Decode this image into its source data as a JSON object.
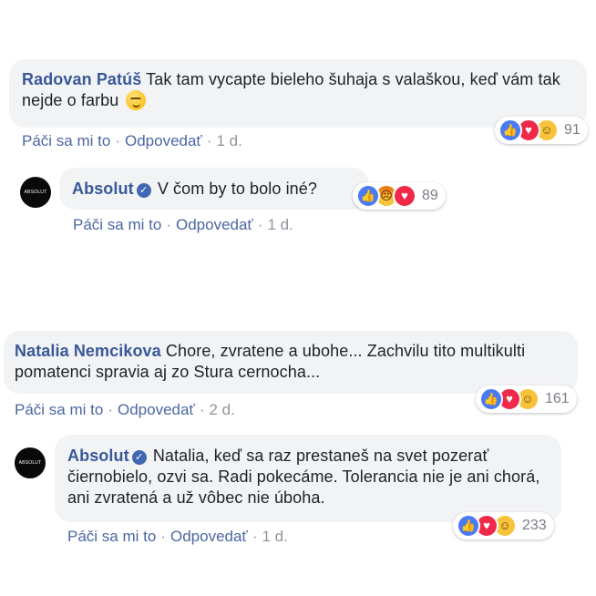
{
  "comments": [
    {
      "author": "Radovan Patúš",
      "text": "Tak tam vycapte bieleho šuhaja s valaškou, keď vám tak nejde o farbu",
      "actions": {
        "like": "Páči sa mi to",
        "reply": "Odpovedať",
        "time": "1 d."
      },
      "reactions": {
        "types": [
          "like",
          "love",
          "haha"
        ],
        "count": "91"
      }
    },
    {
      "author": "Absolut",
      "avatar_text": "ABSOLUT",
      "verified": true,
      "text": "V čom by to bolo iné?",
      "actions": {
        "like": "Páči sa mi to",
        "reply": "Odpovedať",
        "time": "1 d."
      },
      "reactions": {
        "types": [
          "like",
          "angry",
          "love"
        ],
        "count": "89"
      }
    },
    {
      "author": "Natalia Nemcikova",
      "text": "Chore, zvratene a ubohe... Zachvilu tito multikulti pomatenci spravia aj zo Stura cernocha...",
      "actions": {
        "like": "Páči sa mi to",
        "reply": "Odpovedať",
        "time": "2 d."
      },
      "reactions": {
        "types": [
          "like",
          "love",
          "haha"
        ],
        "count": "161"
      }
    },
    {
      "author": "Absolut",
      "avatar_text": "ABSOLUT",
      "verified": true,
      "text": "Natalia, keď sa raz prestaneš na svet pozerať čiernobielo, ozvi sa. Radi pokecáme. Tolerancia nie je ani chorá, ani zvratená a už vôbec nie úboha.",
      "actions": {
        "like": "Páči sa mi to",
        "reply": "Odpovedať",
        "time": "1 d."
      },
      "reactions": {
        "types": [
          "like",
          "love",
          "haha"
        ],
        "count": "233"
      }
    }
  ],
  "icons": {
    "verified": "verified-check-icon",
    "like": "thumbs-up-icon",
    "love": "heart-icon",
    "haha": "laughing-face-icon",
    "angry": "angry-face-icon",
    "emoji": "smirk-emoji-icon"
  },
  "colors": {
    "link": "#385898",
    "bubble": "#f2f3f5",
    "like": "#4a7bf3",
    "love": "#f0284a",
    "haha": "#f7c33a"
  }
}
